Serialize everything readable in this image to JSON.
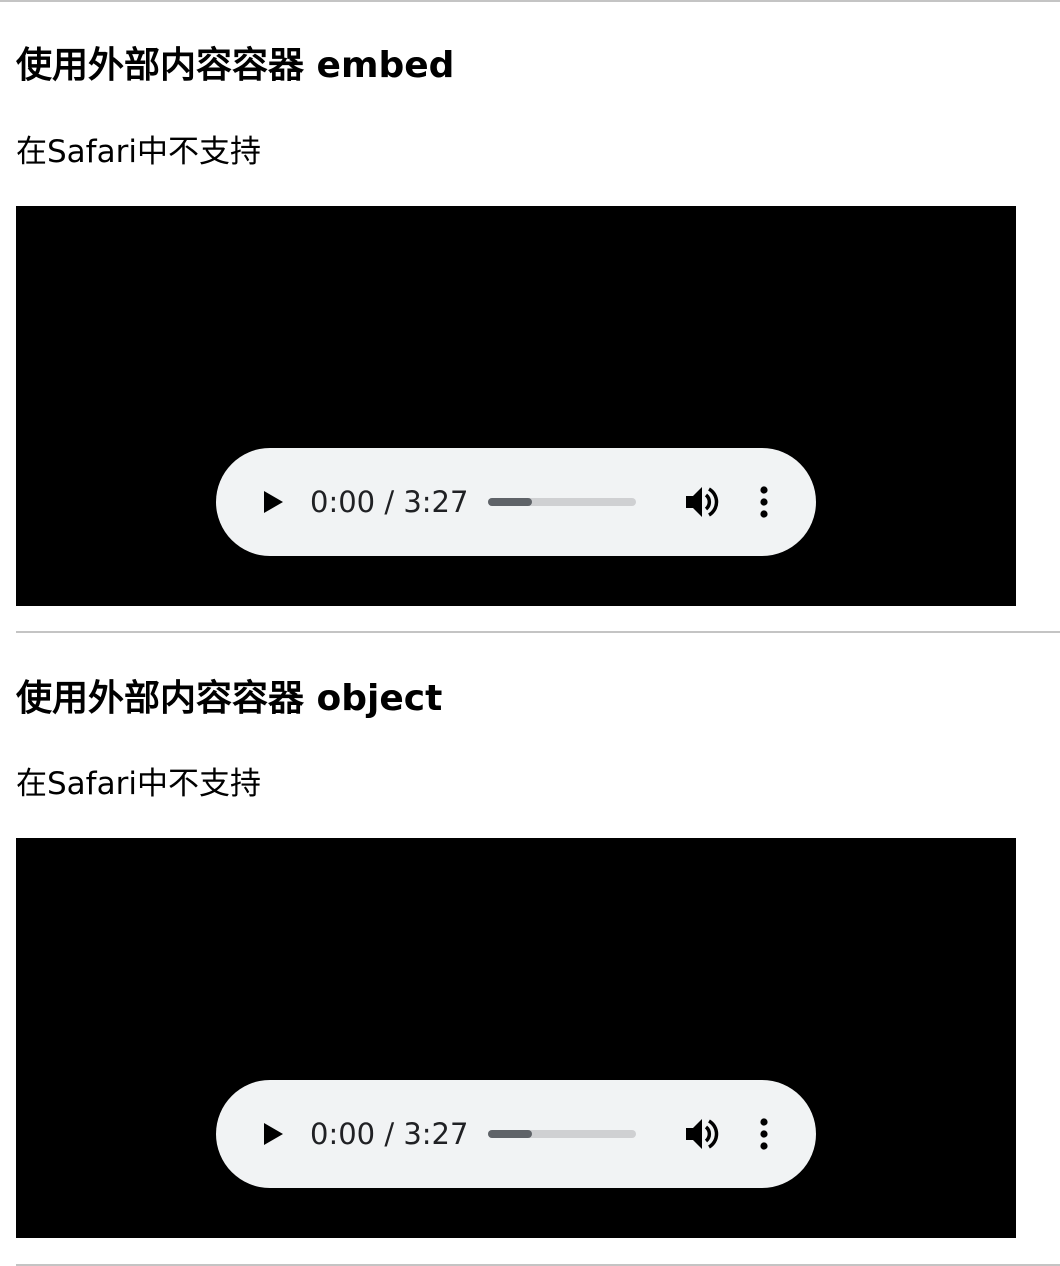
{
  "sections": [
    {
      "title": "使用外部内容容器 embed",
      "note": "在Safari中不支持",
      "player": {
        "time": "0:00 / 3:27",
        "progress": 0.3,
        "play_icon": "play-icon",
        "volume_icon": "volume-icon",
        "menu_icon": "more-vert-icon"
      }
    },
    {
      "title": "使用外部内容容器 object",
      "note": "在Safari中不支持",
      "player": {
        "time": "0:00 / 3:27",
        "progress": 0.3,
        "play_icon": "play-icon",
        "volume_icon": "volume-icon",
        "menu_icon": "more-vert-icon"
      }
    }
  ],
  "colors": {
    "container_bg": "#000000",
    "player_bg": "#f1f3f4",
    "divider": "#c4c4c4"
  }
}
